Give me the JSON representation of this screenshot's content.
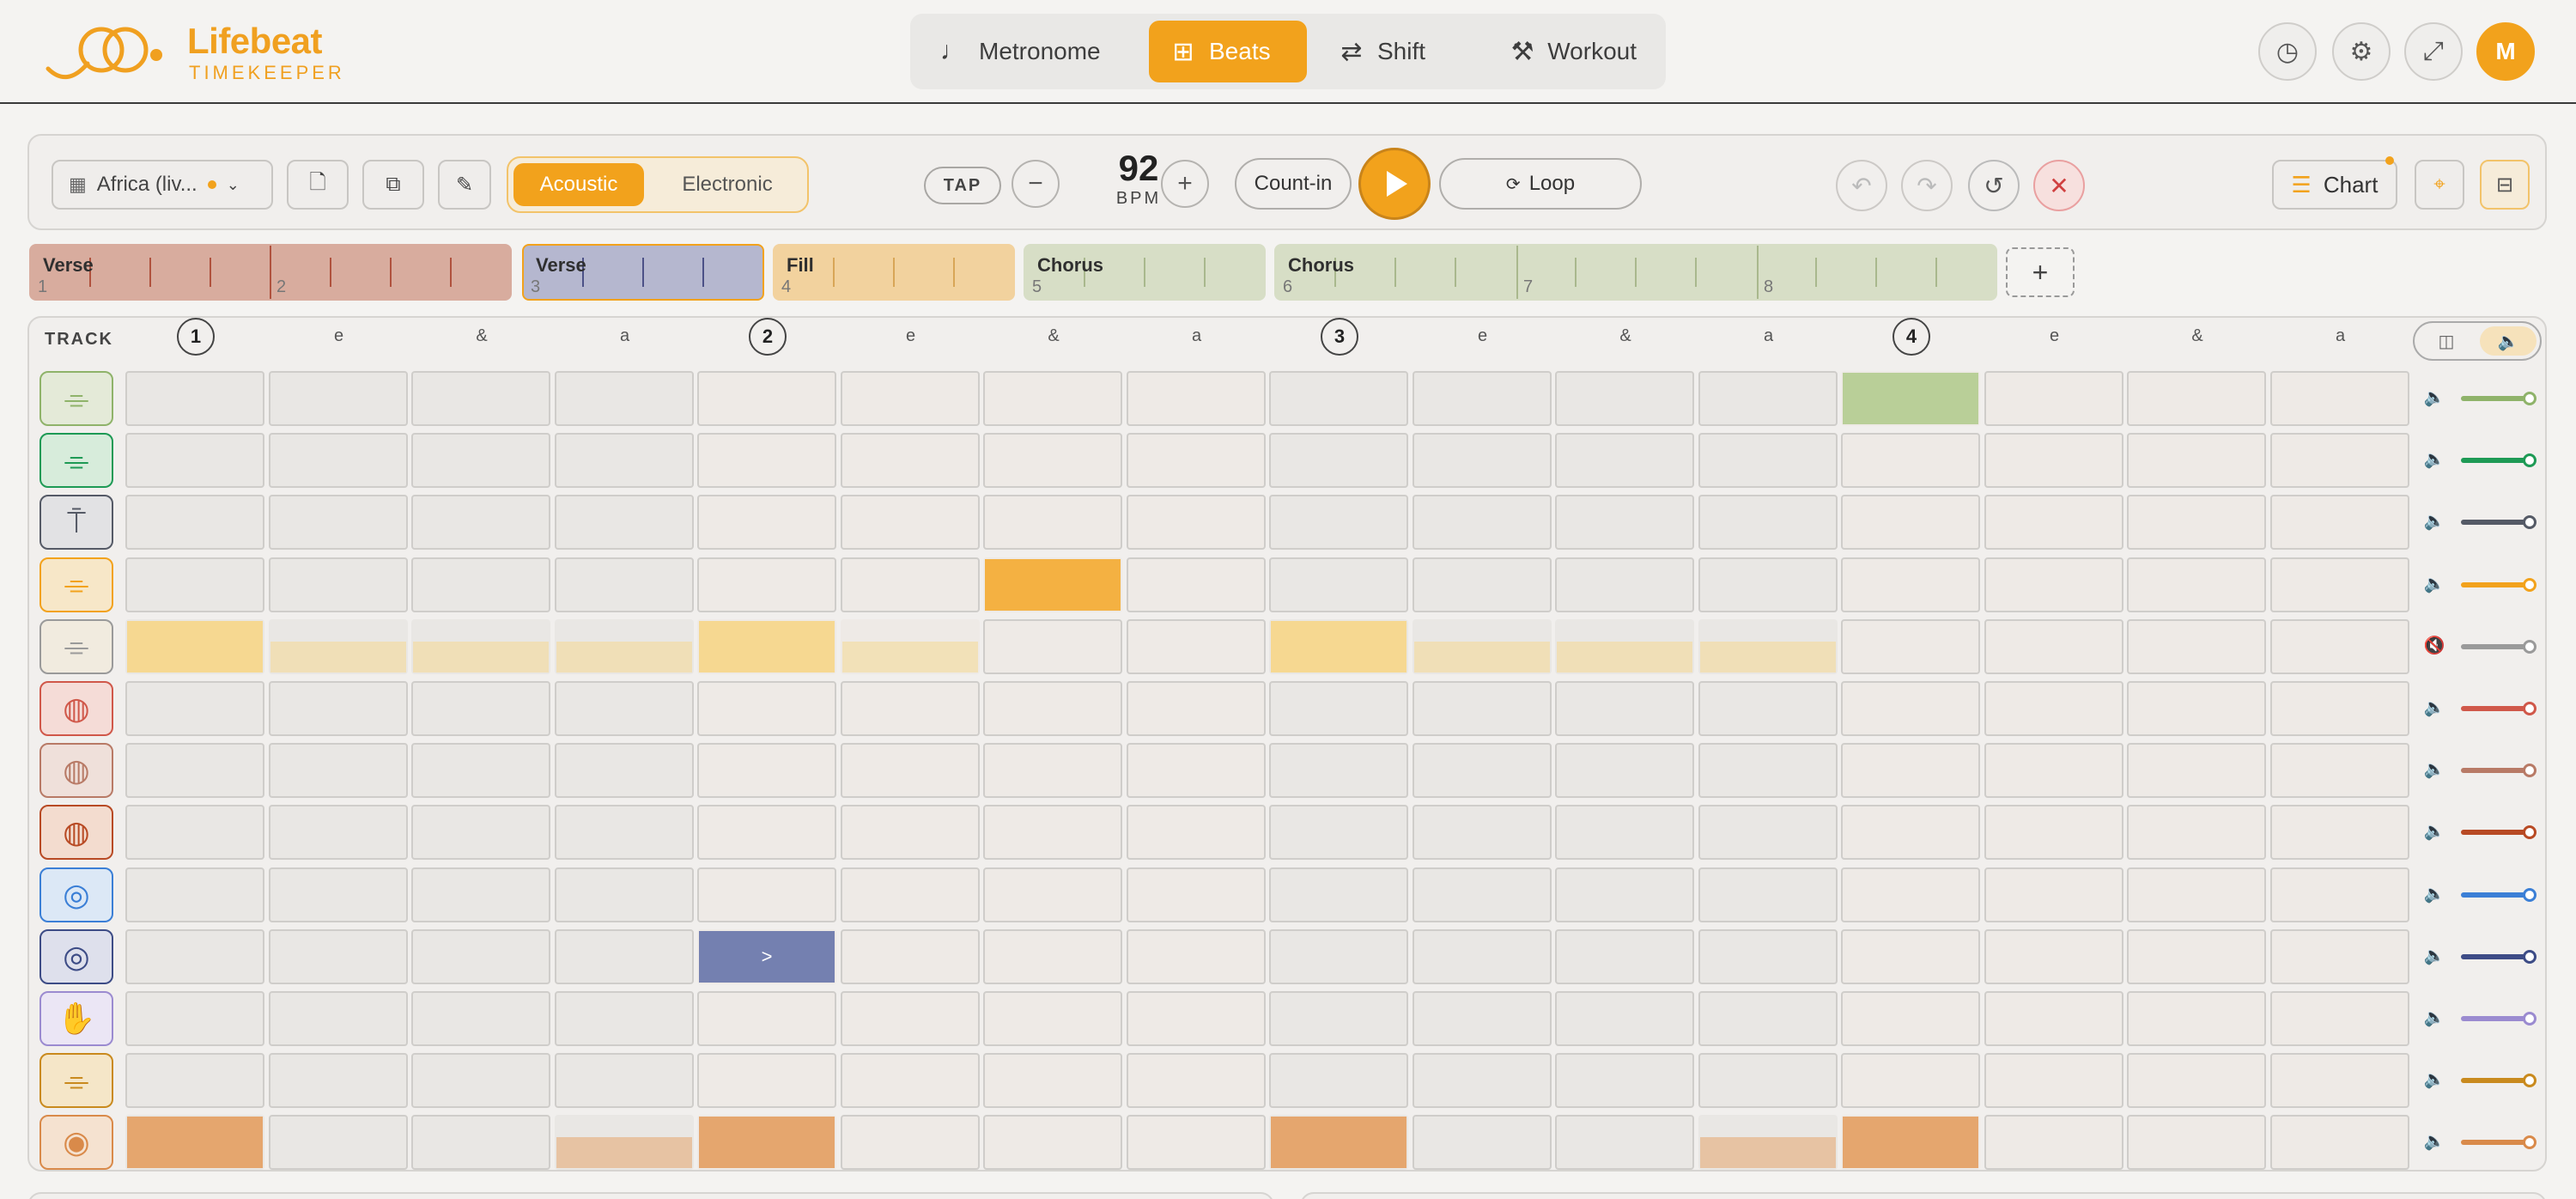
{
  "app": {
    "title": "Lifebeat",
    "subtitle": "TIMEKEEPER",
    "accent": "#f2a21c"
  },
  "nav": {
    "tabs": [
      {
        "label": "Metronome",
        "icon": "note-icon",
        "active": false
      },
      {
        "label": "Beats",
        "icon": "grid-icon",
        "active": true
      },
      {
        "label": "Shift",
        "icon": "swap-icon",
        "active": false
      },
      {
        "label": "Workout",
        "icon": "dumbbell-icon",
        "active": false
      }
    ]
  },
  "header_actions": {
    "history": "history-icon",
    "settings": "gear-icon",
    "fullscreen": "expand-icon",
    "avatar_initial": "M"
  },
  "toolbar": {
    "preset": "Africa (liv...",
    "kits": [
      "Acoustic",
      "Electronic"
    ],
    "active_kit": "Acoustic",
    "tap_label": "TAP",
    "bpm": "92",
    "bpm_label": "BPM",
    "count_in_label": "Count-in",
    "loop_label": "Loop",
    "chart_label": "Chart"
  },
  "sections": [
    {
      "name": "Verse",
      "bars": [
        "1",
        "2"
      ],
      "color": "#d8ac9e",
      "tick": "#b0523e"
    },
    {
      "name": "Verse",
      "bars": [
        "3"
      ],
      "color": "#b5b7cf",
      "tick": "#4c5187",
      "selected": true
    },
    {
      "name": "Fill",
      "bars": [
        "4"
      ],
      "color": "#f2d29e",
      "tick": "#d8a657"
    },
    {
      "name": "Chorus",
      "bars": [
        "5"
      ],
      "color": "#d7dec6",
      "tick": "#a9b88d"
    },
    {
      "name": "Chorus",
      "bars": [
        "6",
        "7",
        "8"
      ],
      "color": "#d7dec6",
      "tick": "#a9b88d"
    }
  ],
  "grid": {
    "track_header": "TRACK",
    "beat_labels": [
      "1",
      "e",
      "&",
      "a",
      "2",
      "e",
      "&",
      "a",
      "3",
      "e",
      "&",
      "a",
      "4",
      "e",
      "&",
      "a"
    ],
    "tracks": [
      {
        "icon": "cymbal-icon",
        "color": "#8fb36a",
        "bg": "#e4ead8",
        "muted": false,
        "volume": 0.95,
        "steps": [
          0,
          0,
          0,
          0,
          0,
          0,
          0,
          0,
          0,
          0,
          0,
          0,
          1,
          0,
          0,
          0
        ],
        "fill": "#b9cf98"
      },
      {
        "icon": "ride-cymbal-icon",
        "color": "#1e9a55",
        "bg": "#d7ecdb",
        "muted": false,
        "volume": 0.95,
        "steps": [
          0,
          0,
          0,
          0,
          0,
          0,
          0,
          0,
          0,
          0,
          0,
          0,
          0,
          0,
          0,
          0
        ],
        "fill": "#1e9a55"
      },
      {
        "icon": "cowbell-icon",
        "color": "#555a66",
        "bg": "#e2e2e4",
        "muted": false,
        "volume": 0.95,
        "steps": [
          0,
          0,
          0,
          0,
          0,
          0,
          0,
          0,
          0,
          0,
          0,
          0,
          0,
          0,
          0,
          0
        ],
        "fill": "#555a66"
      },
      {
        "icon": "crash-icon",
        "color": "#f2a21c",
        "bg": "#f7e7c8",
        "muted": false,
        "volume": 0.95,
        "steps": [
          0,
          0,
          0,
          0,
          0,
          0,
          1,
          0,
          0,
          0,
          0,
          0,
          0,
          0,
          0,
          0
        ],
        "fill": "#f4b142"
      },
      {
        "icon": "hihat-icon",
        "color": "#9a9a9a",
        "bg": "#f1ebdf",
        "muted": true,
        "volume": 0.95,
        "steps": [
          1,
          0.5,
          0.5,
          0.5,
          1,
          0.5,
          0,
          0,
          1,
          0.5,
          0.5,
          0.5,
          0,
          0,
          0,
          0
        ],
        "fill": "#f6d891"
      },
      {
        "icon": "snare-icon",
        "color": "#d0584a",
        "bg": "#f5dcd7",
        "muted": false,
        "volume": 0.95,
        "steps": [
          0,
          0,
          0,
          0,
          0,
          0,
          0,
          0,
          0,
          0,
          0,
          0,
          0,
          0,
          0,
          0
        ],
        "fill": "#d0584a"
      },
      {
        "icon": "tom-high-icon",
        "color": "#b87a66",
        "bg": "#efe0da",
        "muted": false,
        "volume": 0.95,
        "steps": [
          0,
          0,
          0,
          0,
          0,
          0,
          0,
          0,
          0,
          0,
          0,
          0,
          0,
          0,
          0,
          0
        ],
        "fill": "#b87a66"
      },
      {
        "icon": "tom-low-icon",
        "color": "#b84a24",
        "bg": "#f3dccf",
        "muted": false,
        "volume": 0.95,
        "steps": [
          0,
          0,
          0,
          0,
          0,
          0,
          0,
          0,
          0,
          0,
          0,
          0,
          0,
          0,
          0,
          0
        ],
        "fill": "#b84a24"
      },
      {
        "icon": "snare-stick-icon",
        "color": "#3b7fd6",
        "bg": "#dce8f6",
        "muted": false,
        "volume": 0.95,
        "steps": [
          0,
          0,
          0,
          0,
          0,
          0,
          0,
          0,
          0,
          0,
          0,
          0,
          0,
          0,
          0,
          0
        ],
        "fill": "#3b7fd6"
      },
      {
        "icon": "rimshot-icon",
        "color": "#3d4c86",
        "bg": "#dee0ec",
        "muted": false,
        "volume": 0.95,
        "steps": [
          0,
          0,
          0,
          0,
          1,
          0,
          0,
          0,
          0,
          0,
          0,
          0,
          0,
          0,
          0,
          0
        ],
        "fill": "#7480b0",
        "accent_marks": {
          "4": ">"
        }
      },
      {
        "icon": "clap-icon",
        "color": "#9b8bd0",
        "bg": "#ebe6f5",
        "muted": false,
        "volume": 0.95,
        "steps": [
          0,
          0,
          0,
          0,
          0,
          0,
          0,
          0,
          0,
          0,
          0,
          0,
          0,
          0,
          0,
          0
        ],
        "fill": "#9b8bd0"
      },
      {
        "icon": "splash-icon",
        "color": "#c98a1e",
        "bg": "#f5e6c8",
        "muted": false,
        "volume": 0.95,
        "steps": [
          0,
          0,
          0,
          0,
          0,
          0,
          0,
          0,
          0,
          0,
          0,
          0,
          0,
          0,
          0,
          0
        ],
        "fill": "#c98a1e"
      },
      {
        "icon": "kick-drum-icon",
        "color": "#d98a4a",
        "bg": "#f5e2d0",
        "muted": false,
        "volume": 0.95,
        "steps": [
          1,
          0,
          0,
          0.5,
          1,
          0,
          0,
          0,
          1,
          0,
          0,
          0.5,
          1,
          0,
          0,
          0
        ],
        "fill": "#e5a66e"
      }
    ]
  }
}
